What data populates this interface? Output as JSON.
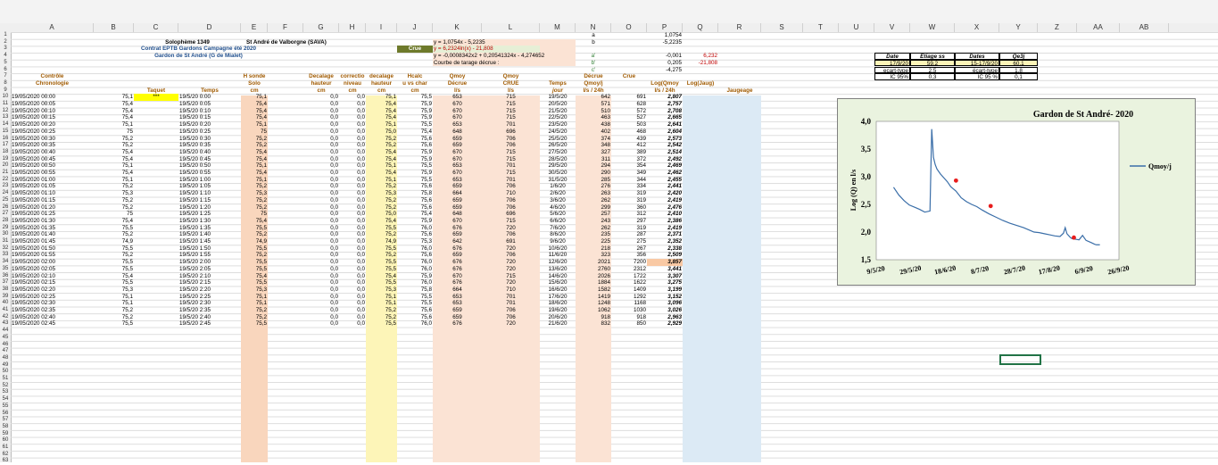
{
  "columns": [
    "A",
    "B",
    "C",
    "D",
    "E",
    "F",
    "G",
    "H",
    "I",
    "J",
    "K",
    "L",
    "M",
    "N",
    "O",
    "P",
    "Q",
    "R",
    "S",
    "T",
    "U",
    "V",
    "W",
    "X",
    "Y",
    "Z",
    "AA",
    "AB"
  ],
  "header_block": {
    "title1": "Solophème 1349",
    "title2": "St André de Valborgne (SAVA)",
    "contract": "Contrat EPTB Gardons Campagne été 2020",
    "station": "Gardon de St André (G de Mialet)",
    "eq1": "y = 1,0754x - 5,2235",
    "crue_label": "Crue",
    "eq2": "y = 6,2324ln(x) - 21,808",
    "eq3": "y = -0,0008342x2 + 0,20541324x - 4,274652",
    "courbe": "Courbe de tarage décrue :",
    "a": "a",
    "b": "b",
    "a_val": "1,0754",
    "b_val": "-5,2235",
    "a2": "a'",
    "b2": "b'",
    "c2": "c'",
    "a2_val": "-0,001",
    "b2_val": "0,205",
    "c2_val": "-4,275",
    "q4": "6,232",
    "q5": "-21,808"
  },
  "col_headers": {
    "controle": "Contrôle",
    "chrono": "Chronologie",
    "taquet": "Taquet",
    "temps": "Temps",
    "hsonde": "H sonde",
    "solo": "Solo",
    "cm": "cm",
    "dec_h": "Decalage",
    "dec_h2": "hauteur",
    "corr": "correctio",
    "corr2": "niveau",
    "dec_h3": "decalage",
    "dec_h4": "hauteur",
    "hcalc": "Hcalc",
    "hcalc2": "u vs char",
    "qmoy": "Qmoy",
    "qmoy2": "Décrue",
    "ls": "l/s",
    "qmoy3": "Qmoy",
    "qmoy4": "CRUE",
    "tps": "Temps",
    "jour": "jour",
    "decrue": "Décrue",
    "qmoyj": "Qmoy/j",
    "ls24": "l/s / 24h",
    "crue": "Crue",
    "logq": "Log(Qmoy",
    "logj": "Log(Jaug)",
    "jaug": "Jaugeage"
  },
  "jaugeage_table": {
    "headers": [
      "Date",
      "Etiage ss",
      "Dates",
      "Qe3j"
    ],
    "row1": [
      "17/9/20",
      "59,2",
      "15-17/9/20",
      "60,1"
    ],
    "row2": [
      "ecart-type",
      "2,5",
      "écart-type",
      "1,8"
    ],
    "row3": [
      "IC 95%",
      "0,3",
      "IC 95 %",
      "0,1"
    ]
  },
  "rows": [
    [
      "19/05/2020 00:00",
      "75,1",
      "***",
      "19/5/20 0:00",
      "75,1",
      "0,0",
      "0,0",
      "75,1",
      "75,5",
      "653",
      "715",
      "19/5/20",
      "642",
      "691",
      "2,807"
    ],
    [
      "19/05/2020 00:05",
      "75,4",
      "",
      "19/5/20 0:05",
      "75,4",
      "0,0",
      "0,0",
      "75,4",
      "75,9",
      "670",
      "715",
      "20/5/20",
      "571",
      "628",
      "2,757"
    ],
    [
      "19/05/2020 00:10",
      "75,4",
      "",
      "19/5/20 0:10",
      "75,4",
      "0,0",
      "0,0",
      "75,4",
      "75,9",
      "670",
      "715",
      "21/5/20",
      "510",
      "572",
      "2,708"
    ],
    [
      "19/05/2020 00:15",
      "75,4",
      "",
      "19/5/20 0:15",
      "75,4",
      "0,0",
      "0,0",
      "75,4",
      "75,9",
      "670",
      "715",
      "22/5/20",
      "463",
      "527",
      "2,665"
    ],
    [
      "19/05/2020 00:20",
      "75,1",
      "",
      "19/5/20 0:20",
      "75,1",
      "0,0",
      "0,0",
      "75,1",
      "75,5",
      "653",
      "701",
      "23/5/20",
      "438",
      "503",
      "2,641"
    ],
    [
      "19/05/2020 00:25",
      "75",
      "",
      "19/5/20 0:25",
      "75",
      "0,0",
      "0,0",
      "75,0",
      "75,4",
      "648",
      "696",
      "24/5/20",
      "402",
      "468",
      "2,604"
    ],
    [
      "19/05/2020 00:30",
      "75,2",
      "",
      "19/5/20 0:30",
      "75,2",
      "0,0",
      "0,0",
      "75,2",
      "75,6",
      "659",
      "706",
      "25/5/20",
      "374",
      "439",
      "2,573"
    ],
    [
      "19/05/2020 00:35",
      "75,2",
      "",
      "19/5/20 0:35",
      "75,2",
      "0,0",
      "0,0",
      "75,2",
      "75,6",
      "659",
      "706",
      "26/5/20",
      "348",
      "412",
      "2,542"
    ],
    [
      "19/05/2020 00:40",
      "75,4",
      "",
      "19/5/20 0:40",
      "75,4",
      "0,0",
      "0,0",
      "75,4",
      "75,9",
      "670",
      "715",
      "27/5/20",
      "327",
      "389",
      "2,514"
    ],
    [
      "19/05/2020 00:45",
      "75,4",
      "",
      "19/5/20 0:45",
      "75,4",
      "0,0",
      "0,0",
      "75,4",
      "75,9",
      "670",
      "715",
      "28/5/20",
      "311",
      "372",
      "2,492"
    ],
    [
      "19/05/2020 00:50",
      "75,1",
      "",
      "19/5/20 0:50",
      "75,1",
      "0,0",
      "0,0",
      "75,1",
      "75,5",
      "653",
      "701",
      "29/5/20",
      "294",
      "354",
      "2,469"
    ],
    [
      "19/05/2020 00:55",
      "75,4",
      "",
      "19/5/20 0:55",
      "75,4",
      "0,0",
      "0,0",
      "75,4",
      "75,9",
      "670",
      "715",
      "30/5/20",
      "290",
      "349",
      "2,462"
    ],
    [
      "19/05/2020 01:00",
      "75,1",
      "",
      "19/5/20 1:00",
      "75,1",
      "0,0",
      "0,0",
      "75,1",
      "75,5",
      "653",
      "701",
      "31/5/20",
      "285",
      "344",
      "2,455"
    ],
    [
      "19/05/2020 01:05",
      "75,2",
      "",
      "19/5/20 1:05",
      "75,2",
      "0,0",
      "0,0",
      "75,2",
      "75,6",
      "659",
      "706",
      "1/6/20",
      "276",
      "334",
      "2,441"
    ],
    [
      "19/05/2020 01:10",
      "75,3",
      "",
      "19/5/20 1:10",
      "75,3",
      "0,0",
      "0,0",
      "75,3",
      "75,8",
      "664",
      "710",
      "2/6/20",
      "263",
      "319",
      "2,420"
    ],
    [
      "19/05/2020 01:15",
      "75,2",
      "",
      "19/5/20 1:15",
      "75,2",
      "0,0",
      "0,0",
      "75,2",
      "75,6",
      "659",
      "706",
      "3/6/20",
      "262",
      "319",
      "2,419"
    ],
    [
      "19/05/2020 01:20",
      "75,2",
      "",
      "19/5/20 1:20",
      "75,2",
      "0,0",
      "0,0",
      "75,2",
      "75,6",
      "659",
      "706",
      "4/6/20",
      "299",
      "360",
      "2,476"
    ],
    [
      "19/05/2020 01:25",
      "75",
      "",
      "19/5/20 1:25",
      "75",
      "0,0",
      "0,0",
      "75,0",
      "75,4",
      "648",
      "696",
      "5/6/20",
      "257",
      "312",
      "2,410"
    ],
    [
      "19/05/2020 01:30",
      "75,4",
      "",
      "19/5/20 1:30",
      "75,4",
      "0,0",
      "0,0",
      "75,4",
      "75,9",
      "670",
      "715",
      "6/6/20",
      "243",
      "297",
      "2,386"
    ],
    [
      "19/05/2020 01:35",
      "75,5",
      "",
      "19/5/20 1:35",
      "75,5",
      "0,0",
      "0,0",
      "75,5",
      "76,0",
      "676",
      "720",
      "7/6/20",
      "262",
      "319",
      "2,419"
    ],
    [
      "19/05/2020 01:40",
      "75,2",
      "",
      "19/5/20 1:40",
      "75,2",
      "0,0",
      "0,0",
      "75,2",
      "75,6",
      "659",
      "706",
      "8/6/20",
      "235",
      "287",
      "2,371"
    ],
    [
      "19/05/2020 01:45",
      "74,9",
      "",
      "19/5/20 1:45",
      "74,9",
      "0,0",
      "0,0",
      "74,9",
      "75,3",
      "642",
      "691",
      "9/6/20",
      "225",
      "275",
      "2,352"
    ],
    [
      "19/05/2020 01:50",
      "75,5",
      "",
      "19/5/20 1:50",
      "75,5",
      "0,0",
      "0,0",
      "75,5",
      "76,0",
      "676",
      "720",
      "10/6/20",
      "218",
      "267",
      "2,338"
    ],
    [
      "19/05/2020 01:55",
      "75,2",
      "",
      "19/5/20 1:55",
      "75,2",
      "0,0",
      "0,0",
      "75,2",
      "75,6",
      "659",
      "706",
      "11/6/20",
      "323",
      "356",
      "2,509"
    ],
    [
      "19/05/2020 02:00",
      "75,5",
      "",
      "19/5/20 2:00",
      "75,5",
      "0,0",
      "0,0",
      "75,5",
      "76,0",
      "676",
      "720",
      "12/6/20",
      "2021",
      "7200",
      "3,857"
    ],
    [
      "19/05/2020 02:05",
      "75,5",
      "",
      "19/5/20 2:05",
      "75,5",
      "0,0",
      "0,0",
      "75,5",
      "76,0",
      "676",
      "720",
      "13/6/20",
      "2760",
      "2312",
      "3,441"
    ],
    [
      "19/05/2020 02:10",
      "75,4",
      "",
      "19/5/20 2:10",
      "75,4",
      "0,0",
      "0,0",
      "75,4",
      "75,9",
      "670",
      "715",
      "14/6/20",
      "2026",
      "1722",
      "3,307"
    ],
    [
      "19/05/2020 02:15",
      "75,5",
      "",
      "19/5/20 2:15",
      "75,5",
      "0,0",
      "0,0",
      "75,5",
      "76,0",
      "676",
      "720",
      "15/6/20",
      "1884",
      "1622",
      "3,275"
    ],
    [
      "19/05/2020 02:20",
      "75,3",
      "",
      "19/5/20 2:20",
      "75,3",
      "0,0",
      "0,0",
      "75,3",
      "75,8",
      "664",
      "710",
      "16/6/20",
      "1582",
      "1409",
      "3,199"
    ],
    [
      "19/05/2020 02:25",
      "75,1",
      "",
      "19/5/20 2:25",
      "75,1",
      "0,0",
      "0,0",
      "75,1",
      "75,5",
      "653",
      "701",
      "17/6/20",
      "1419",
      "1292",
      "3,152"
    ],
    [
      "19/05/2020 02:30",
      "75,1",
      "",
      "19/5/20 2:30",
      "75,1",
      "0,0",
      "0,0",
      "75,1",
      "75,5",
      "653",
      "701",
      "18/6/20",
      "1248",
      "1168",
      "3,096"
    ],
    [
      "19/05/2020 02:35",
      "75,2",
      "",
      "19/5/20 2:35",
      "75,2",
      "0,0",
      "0,0",
      "75,2",
      "75,6",
      "659",
      "706",
      "19/6/20",
      "1062",
      "1030",
      "3,026"
    ],
    [
      "19/05/2020 02:40",
      "75,2",
      "",
      "19/5/20 2:40",
      "75,2",
      "0,0",
      "0,0",
      "75,2",
      "75,6",
      "659",
      "706",
      "20/6/20",
      "918",
      "918",
      "2,963"
    ],
    [
      "19/05/2020 02:45",
      "75,5",
      "",
      "19/5/20 2:45",
      "75,5",
      "0,0",
      "0,0",
      "75,5",
      "76,0",
      "676",
      "720",
      "21/6/20",
      "832",
      "850",
      "2,929"
    ]
  ],
  "chart_data": {
    "type": "line",
    "title": "Gardon de St André- 2020",
    "ylabel": "Log (Q) en l/s",
    "ylim": [
      1.5,
      4.0
    ],
    "yticks": [
      "4,0",
      "3,5",
      "3,0",
      "2,5",
      "2,0",
      "1,5"
    ],
    "xticks": [
      "9/5/20",
      "29/5/20",
      "18/6/20",
      "8/7/20",
      "28/7/20",
      "17/8/20",
      "6/9/20",
      "26/9/20"
    ],
    "series": [
      {
        "name": "Qmoy/j",
        "color": "#3a6ea8",
        "x": [
          19,
          22,
          25,
          28,
          31,
          34,
          37,
          40,
          41,
          42,
          43,
          44,
          46,
          48,
          50,
          52,
          55,
          58,
          61,
          64,
          67,
          70,
          74,
          78,
          82,
          86,
          90,
          94,
          97,
          100,
          103,
          106,
          109,
          112,
          115,
          117,
          118,
          119,
          121,
          122,
          124,
          126,
          128,
          130,
          133,
          135,
          136,
          138
        ],
        "values": [
          2.81,
          2.67,
          2.57,
          2.49,
          2.45,
          2.41,
          2.36,
          2.38,
          3.86,
          3.35,
          3.22,
          3.14,
          3.05,
          2.98,
          2.91,
          2.82,
          2.74,
          2.62,
          2.55,
          2.5,
          2.46,
          2.4,
          2.33,
          2.27,
          2.21,
          2.16,
          2.12,
          2.08,
          2.04,
          2.0,
          1.99,
          1.97,
          1.95,
          1.93,
          1.92,
          1.98,
          2.08,
          1.97,
          1.9,
          1.88,
          1.87,
          1.86,
          1.94,
          1.85,
          1.81,
          1.78,
          1.77,
          1.77
        ]
      },
      {
        "name": "",
        "color": "#e81c1c",
        "x": [
          55,
          75,
          123
        ],
        "values": [
          2.93,
          2.47,
          1.9
        ],
        "markers_only": true
      }
    ],
    "xlim": [
      9,
      149
    ]
  },
  "colors": {
    "qmoy_bg": "#fbe3d4",
    "qcrue_bg": "#fbe3d4",
    "hsonde_bg": "#f9d6bd",
    "dec_bg": "#fdf5b8",
    "jaug_bg": "#dceaf5",
    "crue_bg": "#6e7a2b",
    "plot_bg": "#ffffff",
    "chart_bg": "#eaf3df"
  }
}
